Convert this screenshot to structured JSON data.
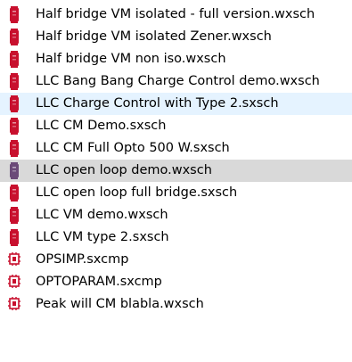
{
  "file_list": {
    "items": [
      {
        "label": "Half bridge VM isolated - full version.wxsch",
        "icon": "schematic-file-icon",
        "state": "normal"
      },
      {
        "label": "Half bridge VM isolated Zener.wxsch",
        "icon": "schematic-file-icon",
        "state": "normal"
      },
      {
        "label": "Half bridge VM non iso.wxsch",
        "icon": "schematic-file-icon",
        "state": "normal"
      },
      {
        "label": "LLC Bang Bang Charge Control demo.wxsch",
        "icon": "schematic-file-icon",
        "state": "normal"
      },
      {
        "label": "LLC Charge Control with Type 2.sxsch",
        "icon": "schematic-file-icon",
        "state": "hovered"
      },
      {
        "label": "LLC CM Demo.sxsch",
        "icon": "schematic-file-icon",
        "state": "normal"
      },
      {
        "label": "LLC CM Full Opto 500 W.sxsch",
        "icon": "schematic-file-icon",
        "state": "normal"
      },
      {
        "label": "LLC open loop demo.wxsch",
        "icon": "schematic-file-icon",
        "state": "selected"
      },
      {
        "label": "LLC open loop full bridge.sxsch",
        "icon": "schematic-file-icon",
        "state": "normal"
      },
      {
        "label": "LLC VM demo.wxsch",
        "icon": "schematic-file-icon",
        "state": "normal"
      },
      {
        "label": "LLC VM type 2.sxsch",
        "icon": "schematic-file-icon",
        "state": "normal"
      },
      {
        "label": "OPSIMP.sxcmp",
        "icon": "component-file-icon",
        "state": "normal"
      },
      {
        "label": "OPTOPARAM.sxcmp",
        "icon": "component-file-icon",
        "state": "normal"
      },
      {
        "label": "Peak will CM blabla.wxsch",
        "icon": "component-file-icon",
        "state": "normal"
      }
    ]
  },
  "colors": {
    "hover_bg": "#e5f3ff",
    "selected_bg": "#d9d9d9",
    "icon_red": "#c8102e",
    "icon_selected": "#6b4a78"
  }
}
